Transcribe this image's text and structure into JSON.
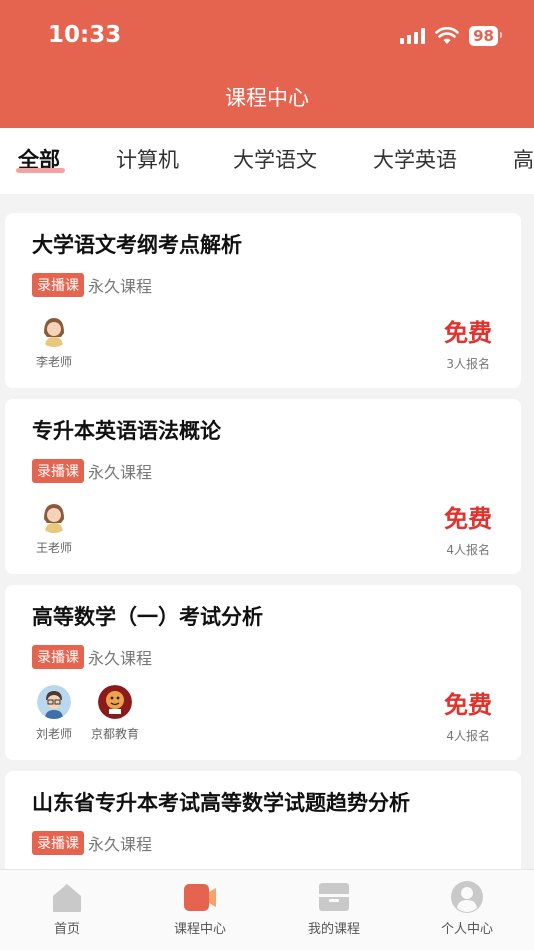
{
  "status_bar": {
    "time": "10:33",
    "battery": "98"
  },
  "header": {
    "title": "课程中心"
  },
  "tabs": [
    {
      "label": "全部",
      "active": true
    },
    {
      "label": "计算机"
    },
    {
      "label": "大学语文"
    },
    {
      "label": "大学英语"
    },
    {
      "label": "高"
    }
  ],
  "courses": [
    {
      "title": "大学语文考纲考点解析",
      "tag": "录播课",
      "tag_note": "永久课程",
      "teachers": [
        "李老师"
      ],
      "price": "免费",
      "enroll": "3人报名"
    },
    {
      "title": "专升本英语语法概论",
      "tag": "录播课",
      "tag_note": "永久课程",
      "teachers": [
        "王老师"
      ],
      "price": "免费",
      "enroll": "4人报名"
    },
    {
      "title": "高等数学（一）考试分析",
      "tag": "录播课",
      "tag_note": "永久课程",
      "teachers": [
        "刘老师",
        "京都教育"
      ],
      "price": "免费",
      "enroll": "4人报名"
    },
    {
      "title": "山东省专升本考试高等数学试题趋势分析",
      "tag": "录播课",
      "tag_note": "永久课程"
    }
  ],
  "bottom_nav": [
    {
      "label": "首页",
      "icon": "home-icon"
    },
    {
      "label": "课程中心",
      "icon": "video-icon",
      "active": true
    },
    {
      "label": "我的课程",
      "icon": "inbox-icon"
    },
    {
      "label": "个人中心",
      "icon": "user-icon"
    }
  ],
  "colors": {
    "accent": "#e5644f",
    "price": "#e0332d",
    "tab_underline": "#f3a3a0"
  }
}
